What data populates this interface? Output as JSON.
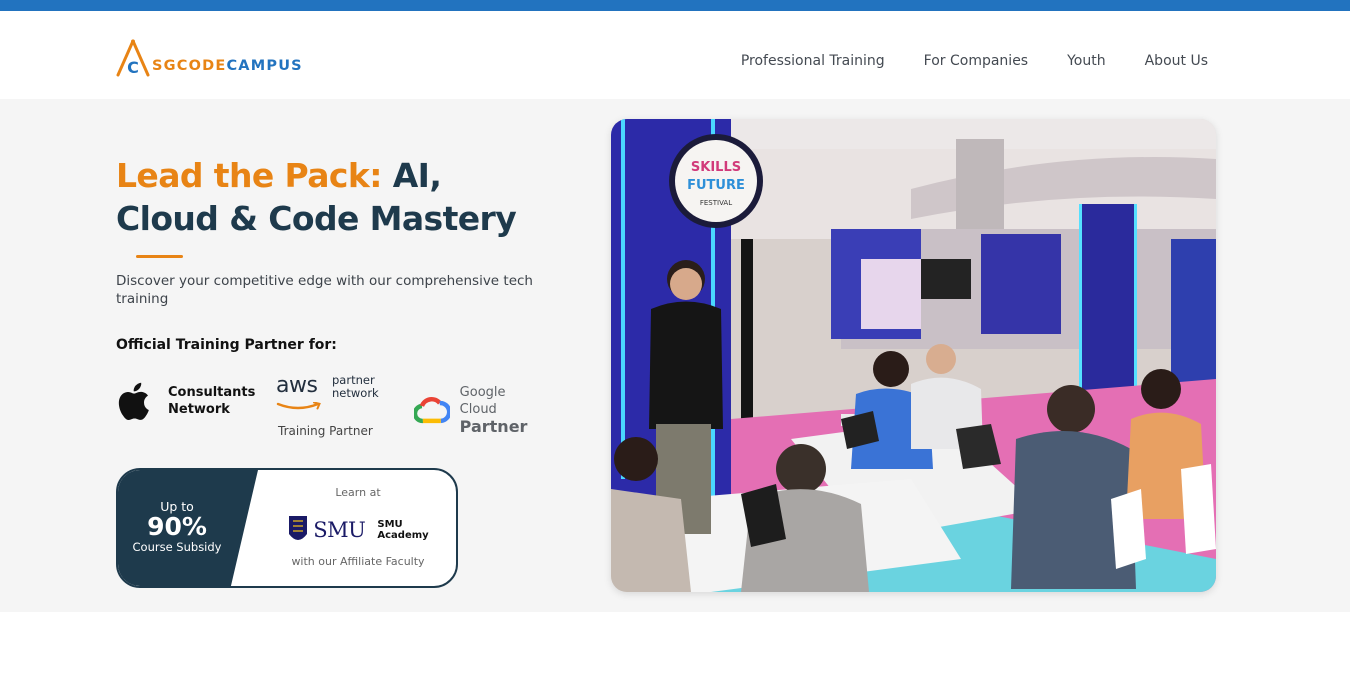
{
  "brand": {
    "logo_letter": "C",
    "logo_sg": "SG",
    "logo_code": "CODE",
    "logo_campus": "CAMPUS"
  },
  "nav": {
    "items": [
      {
        "label": "Professional Training"
      },
      {
        "label": "For Companies"
      },
      {
        "label": "Youth"
      },
      {
        "label": "About Us"
      }
    ]
  },
  "hero": {
    "headline_accent": "Lead the Pack:",
    "headline_rest": " AI, Cloud & Code Mastery",
    "subtitle": "Discover your competitive edge with our comprehensive tech training",
    "partner_label": "Official Training Partner for:"
  },
  "partners": {
    "apple_line1": "Consultants",
    "apple_line2": "Network",
    "aws_word": "aws",
    "aws_line1": "partner",
    "aws_line2": "network",
    "aws_caption": "Training Partner",
    "google_line1": "Google Cloud",
    "google_line2": "Partner"
  },
  "subsidy": {
    "up_to": "Up to",
    "percent": "90%",
    "caption": "Course Subsidy",
    "learn_at": "Learn at",
    "smu": "SMU",
    "smu_academy_line1": "SMU",
    "smu_academy_line2": "Academy",
    "affiliate": "with our Affiliate Faculty"
  },
  "photo": {
    "sign_line1": "SKILLS",
    "sign_line2": "FUTURE",
    "sign_line3": "FESTIVAL"
  },
  "colors": {
    "brand_blue": "#2273bf",
    "brand_orange": "#e88415",
    "navy": "#1e3a4c"
  }
}
